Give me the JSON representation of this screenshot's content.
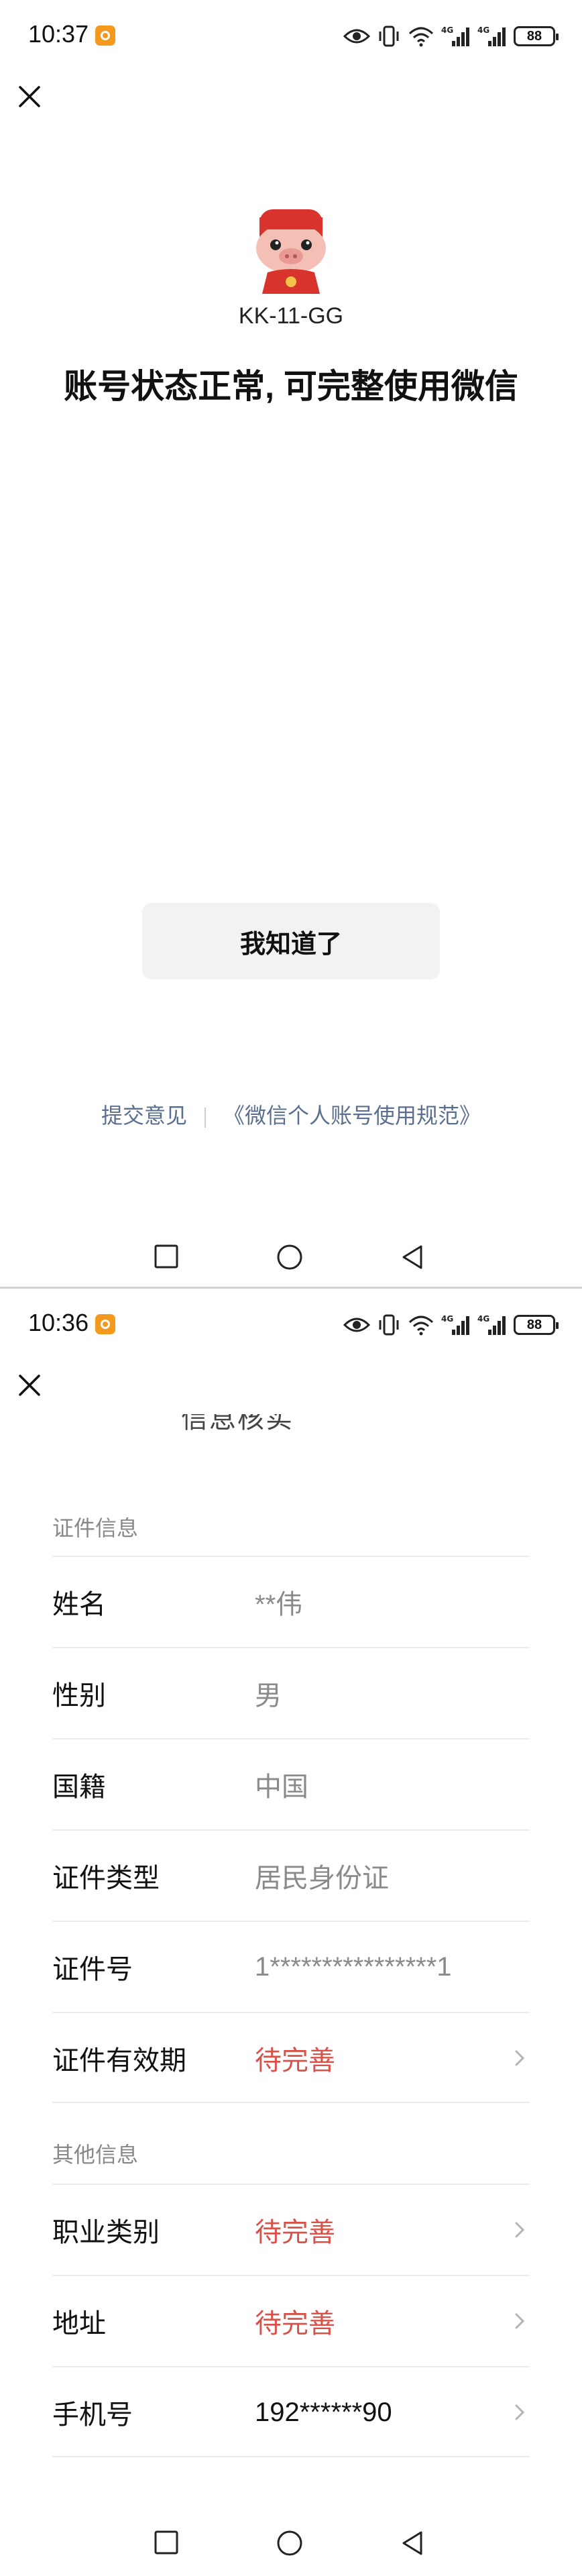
{
  "screen1": {
    "status_bar": {
      "time": "10:37",
      "battery": "88"
    },
    "account_name": "KK-11-GG",
    "status_message": "账号状态正常, 可完整使用微信",
    "ack_button": "我知道了",
    "links": {
      "feedback": "提交意见",
      "policy": "《微信个人账号使用规范》"
    }
  },
  "screen2": {
    "status_bar": {
      "time": "10:36",
      "battery": "88"
    },
    "partial_title": "信息核实",
    "sections": [
      {
        "label": "证件信息",
        "rows": [
          {
            "key": "姓名",
            "value": "**伟"
          },
          {
            "key": "性别",
            "value": "男"
          },
          {
            "key": "国籍",
            "value": "中国"
          },
          {
            "key": "证件类型",
            "value": "居民身份证"
          },
          {
            "key": "证件号",
            "value": "1****************1"
          },
          {
            "key": "证件有效期",
            "value": "待完善"
          }
        ]
      },
      {
        "label": "其他信息",
        "rows": [
          {
            "key": "职业类别",
            "value": "待完善"
          },
          {
            "key": "地址",
            "value": "待完善"
          },
          {
            "key": "手机号",
            "value": "192******90"
          }
        ]
      }
    ]
  },
  "colors": {
    "warning": "#d9524a",
    "link": "#5a6f8f",
    "button_bg": "#f2f2f2"
  },
  "icons": [
    "close-icon",
    "eye-icon",
    "vibrate-icon",
    "wifi-icon",
    "signal-4g-icon",
    "battery-icon",
    "chevron-right-icon",
    "nav-recents-icon",
    "nav-home-icon",
    "nav-back-icon"
  ]
}
